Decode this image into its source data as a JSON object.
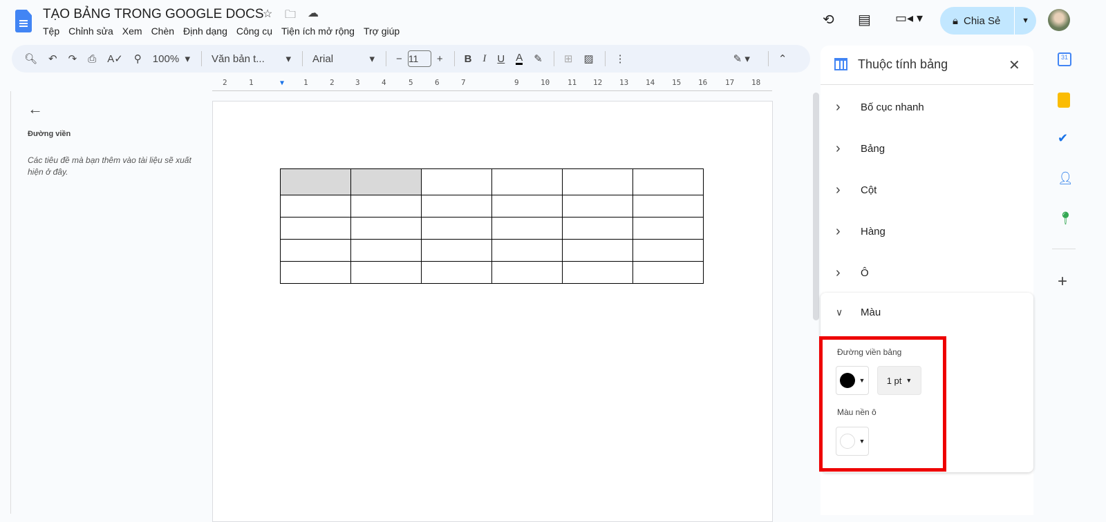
{
  "doc": {
    "title": "TẠO BẢNG TRONG GOOGLE DOCS"
  },
  "menu": [
    "Tệp",
    "Chỉnh sửa",
    "Xem",
    "Chèn",
    "Định dạng",
    "Công cụ",
    "Tiện ích mở rộng",
    "Trợ giúp"
  ],
  "header": {
    "share_label": "Chia Sẻ"
  },
  "toolbar": {
    "zoom": "100%",
    "style": "Văn bản t...",
    "font": "Arial",
    "font_size": "11"
  },
  "ruler": [
    "2",
    "1",
    "1",
    "2",
    "3",
    "4",
    "5",
    "6",
    "7",
    "9",
    "10",
    "11",
    "12",
    "13",
    "14",
    "15",
    "16",
    "17",
    "18"
  ],
  "outline": {
    "title": "Đường viền",
    "hint": "Các tiêu đề mà bạn thêm vào tài liệu sẽ xuất hiện ở đây."
  },
  "panel": {
    "title": "Thuộc tính bảng",
    "sections": [
      "Bố cục nhanh",
      "Bảng",
      "Cột",
      "Hàng",
      "Ô",
      "Màu"
    ],
    "border_label": "Đường viền bảng",
    "border_color": "#000000",
    "border_width": "1 pt",
    "bg_label": "Màu nền ô",
    "bg_color": "#ffffff"
  },
  "table": {
    "rows": 5,
    "cols": 6
  },
  "colors": {
    "accent": "#0b57d0",
    "share_bg": "#c2e7ff",
    "highlight": "#e00000"
  }
}
